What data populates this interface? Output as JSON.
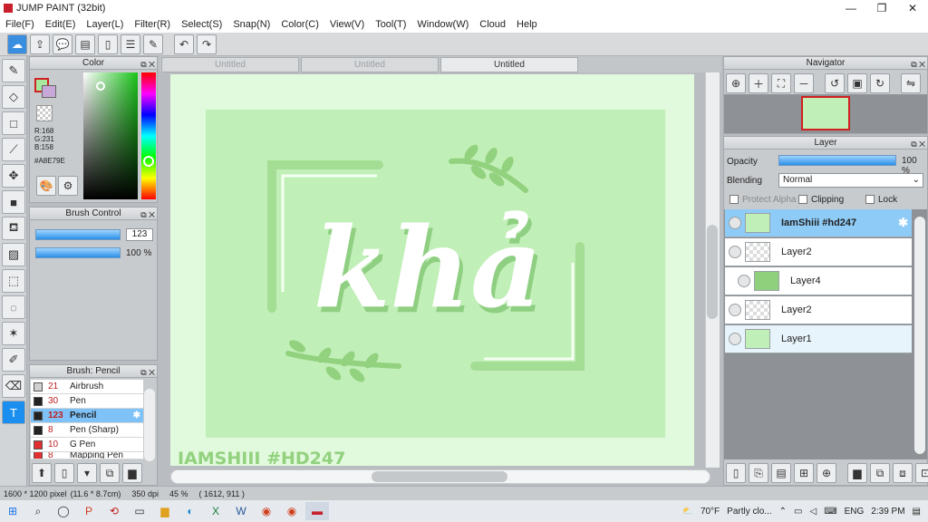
{
  "window": {
    "title": "JUMP PAINT (32bit)",
    "min": "—",
    "max": "❐",
    "close": "✕"
  },
  "menu": [
    "File(F)",
    "Edit(E)",
    "Layer(L)",
    "Filter(R)",
    "Select(S)",
    "Snap(N)",
    "Color(C)",
    "View(V)",
    "Tool(T)",
    "Window(W)",
    "Cloud",
    "Help"
  ],
  "color_panel": {
    "title": "Color",
    "r": "R:168",
    "g": "G:231",
    "b": "B:158",
    "hex": "#A8E79E",
    "current_color": "#A8E79E"
  },
  "brush_control": {
    "title": "Brush Control",
    "size": "123",
    "opacity": "100 %",
    "size_fraction": 0.95,
    "opacity_fraction": 1.0
  },
  "brush_list": {
    "title": "Brush: Pencil",
    "items": [
      {
        "size": "21",
        "name": "Airbrush",
        "color": "#d0d0d0"
      },
      {
        "size": "30",
        "name": "Pen",
        "color": "#222222"
      },
      {
        "size": "123",
        "name": "Pencil",
        "color": "#222222"
      },
      {
        "size": "8",
        "name": "Pen (Sharp)",
        "color": "#222222"
      },
      {
        "size": "10",
        "name": "G Pen",
        "color": "#e03030"
      },
      {
        "size": "8",
        "name": "Mapping Pen",
        "color": "#e03030"
      }
    ]
  },
  "doc_tabs": [
    "Untitled",
    "Untitled",
    "Untitled"
  ],
  "canvas": {
    "title_text": "khả",
    "watermark": "IAMSHIII #HD247",
    "bg": "#e1f9dc",
    "inner": "#c1efb8",
    "accent": "#a4dd94"
  },
  "navigator": {
    "title": "Navigator"
  },
  "layer_panel": {
    "title": "Layer",
    "opacity_label": "Opacity",
    "opacity_value": "100 %",
    "blending_label": "Blending",
    "blending_value": "Normal",
    "protect_alpha": "Protect Alpha",
    "clipping": "Clipping",
    "lock": "Lock",
    "layers": [
      {
        "name": "IamShiii #hd247",
        "state": "selected"
      },
      {
        "name": "Layer2",
        "state": "normal"
      },
      {
        "name": "Layer4",
        "state": "normal"
      },
      {
        "name": "Layer2",
        "state": "normal"
      },
      {
        "name": "Layer1",
        "state": "current"
      }
    ]
  },
  "status": {
    "size": "1600 * 1200 pixel",
    "cm": "(11.6 * 8.7cm)",
    "dpi": "350 dpi",
    "zoom": "45 %",
    "coords": "( 1612, 911 )"
  },
  "taskbar": {
    "weather_temp": "70°F",
    "weather_text": "Partly clo...",
    "lang": "ENG",
    "time": "2:39 PM"
  }
}
